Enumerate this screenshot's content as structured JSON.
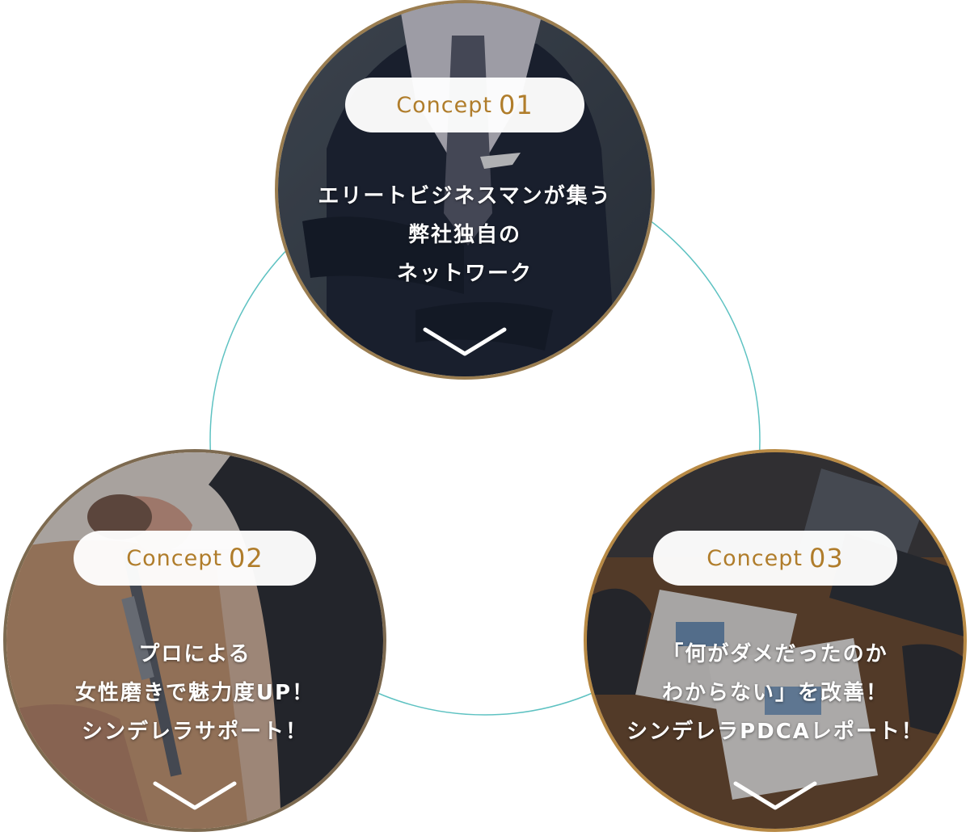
{
  "concepts": [
    {
      "label": "Concept",
      "number": "01",
      "lines": [
        "エリートビジネスマンが集う",
        "弊社独自の",
        "ネットワーク"
      ],
      "photo_icon": "businessman-photo"
    },
    {
      "label": "Concept",
      "number": "02",
      "lines": [
        "プロによる",
        "女性磨きで魅力度UP！",
        "シンデレラサポート！"
      ],
      "photo_icon": "makeup-brush-photo"
    },
    {
      "label": "Concept",
      "number": "03",
      "lines": [
        "「何がダメだったのか",
        "わからない」を改善！",
        "シンデレラPDCAレポート！"
      ],
      "photo_icon": "meeting-documents-photo"
    }
  ],
  "colors": {
    "accent": "#b07d2b",
    "ring": "#3ab3b3",
    "border_gold": "#8a6a3a"
  }
}
